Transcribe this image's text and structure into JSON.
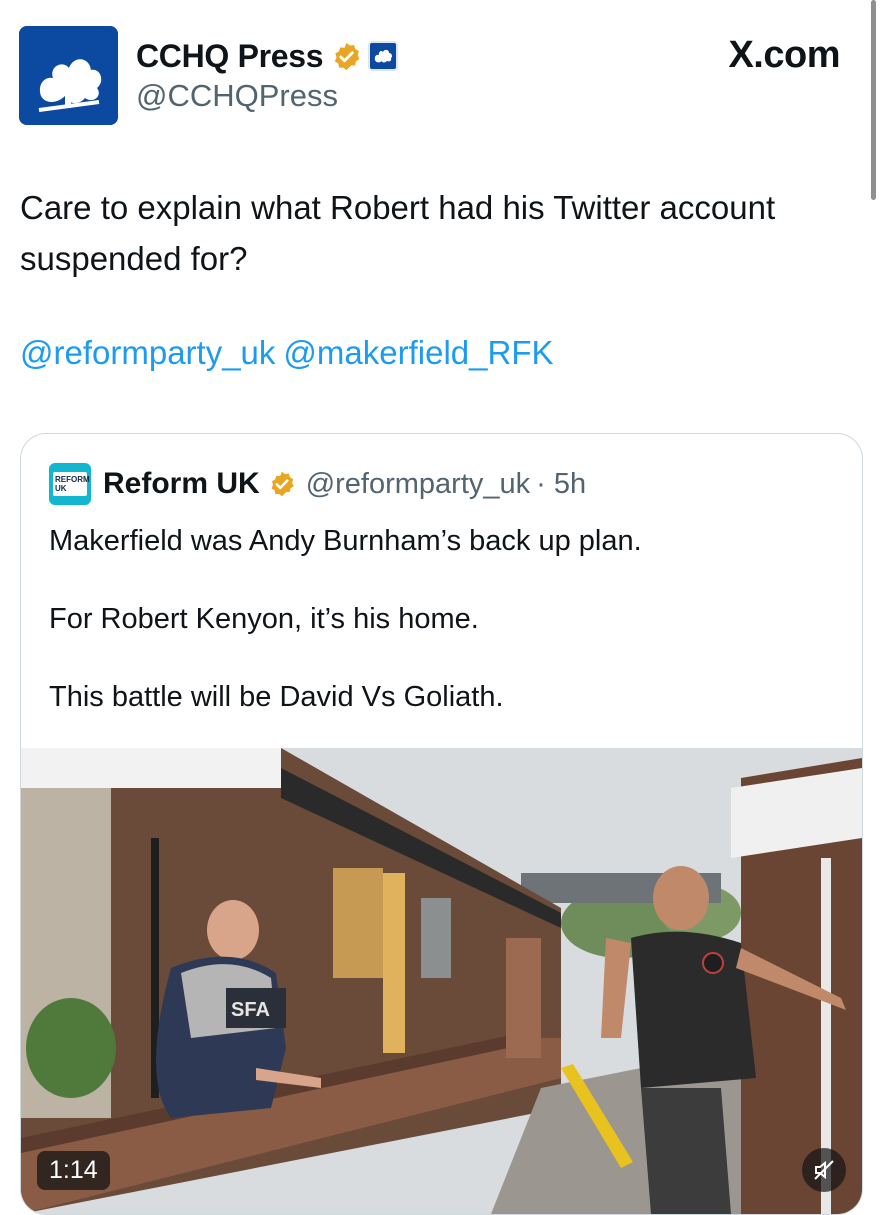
{
  "app": {
    "watermark": "X.com"
  },
  "author": {
    "display_name": "CCHQ Press",
    "handle": "@CCHQPress",
    "verified_icon": "gold-check-icon",
    "affiliation_icon": "conservatives-tree-icon"
  },
  "tweet": {
    "text": "Care to explain what Robert had his Twitter account suspended for?",
    "mentions": [
      "@reformparty_uk",
      "@makerfield_RFK"
    ]
  },
  "quote": {
    "display_name": "Reform UK",
    "handle": "@reformparty_uk",
    "time": "· 5h",
    "logo_text": "REFORM UK",
    "paragraphs": [
      "Makerfield was Andy Burnham’s back up plan.",
      "For Robert Kenyon, it’s his home.",
      "This battle will be David Vs Goliath."
    ],
    "video": {
      "duration": "1:14",
      "mute_icon": "speaker-muted-icon",
      "shirt_text": "SFA"
    }
  },
  "colors": {
    "link": "#1d9bf0",
    "secondary_text": "#536471",
    "cchq_blue": "#0c4aa1",
    "reform_cyan": "#12b6cf",
    "verified_gold": "#e8a623"
  }
}
